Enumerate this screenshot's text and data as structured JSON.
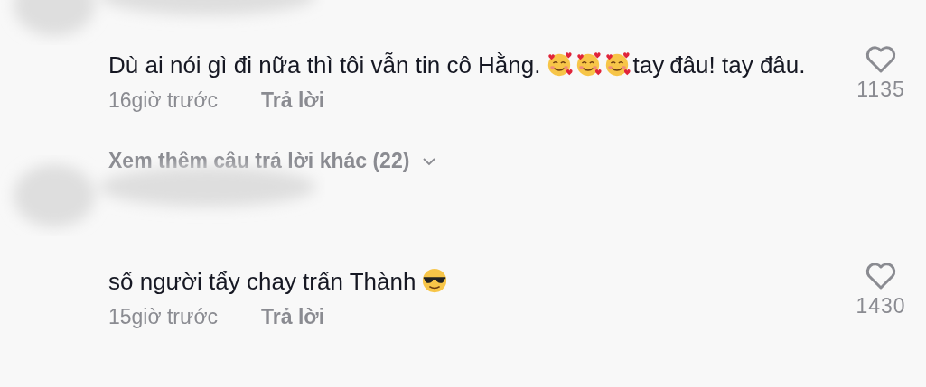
{
  "comments": [
    {
      "blurred_name": true,
      "segments": [
        {
          "kind": "text",
          "text": "Dù ai nói gì đi nữa thì tôi vẫn tin cô Hằng."
        },
        {
          "kind": "hearts_face_emoji"
        },
        {
          "kind": "hearts_face_emoji"
        },
        {
          "kind": "hearts_face_emoji"
        },
        {
          "kind": "text",
          "text": "tay"
        },
        {
          "kind": "text",
          "text": "đâu! tay đâu."
        }
      ],
      "time": "16giờ trước",
      "reply": "Trả lời",
      "likes": "1135",
      "more_replies": "Xem thêm câu trả lời khác (22)"
    },
    {
      "blurred_name": true,
      "segments": [
        {
          "kind": "text",
          "text": "số người tẩy chay trấn Thành"
        },
        {
          "kind": "sunglasses_face_emoji"
        }
      ],
      "time": "15giờ trước",
      "reply": "Trả lời",
      "likes": "1430"
    }
  ]
}
